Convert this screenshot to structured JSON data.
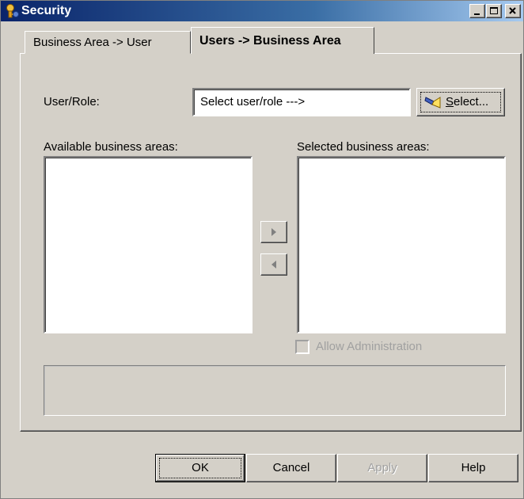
{
  "window": {
    "title": "Security",
    "icon": "security-key-icon",
    "caption_buttons": [
      "minimize-icon",
      "maximize-icon",
      "close-icon"
    ]
  },
  "tabs": [
    {
      "label": "Business Area -> User",
      "active": false
    },
    {
      "label": "Users -> Business Area",
      "active": true
    }
  ],
  "form": {
    "user_role_label": "User/Role:",
    "user_role_value": "Select user/role --->",
    "select_button": {
      "underlined_char": "S",
      "rest": "elect...",
      "icon": "flashlight-icon"
    },
    "available_label": "Available business areas:",
    "selected_label": "Selected business areas:",
    "available_items": [],
    "selected_items": [],
    "move_right_icon": "arrow-right-icon",
    "move_left_icon": "arrow-left-icon",
    "allow_admin_label": "Allow Administration",
    "allow_admin_checked": false
  },
  "buttons": {
    "ok": "OK",
    "cancel": "Cancel",
    "apply": "Apply",
    "help": "Help"
  },
  "colors": {
    "face": "#d4d0c8",
    "title_start": "#0a246a",
    "title_end": "#a6caf0",
    "disabled_text": "#a0a0a0"
  }
}
